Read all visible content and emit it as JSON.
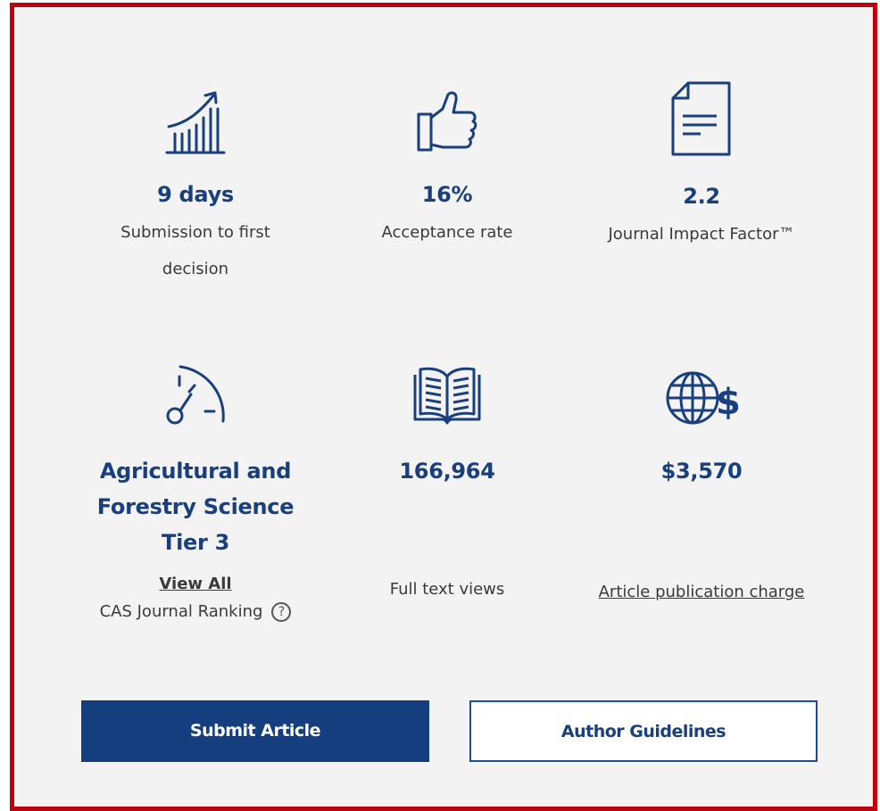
{
  "metrics": [
    {
      "icon": "growth-chart-icon",
      "value": "9 days",
      "label_line1": "Submission to first",
      "label_line2": "decision"
    },
    {
      "icon": "thumbs-up-icon",
      "value": "16%",
      "label": "Acceptance rate"
    },
    {
      "icon": "document-icon",
      "value": "2.2",
      "label": "Journal Impact Factor™"
    },
    {
      "icon": "speedometer-icon",
      "value_line1": "Agricultural and",
      "value_line2": "Forestry Science",
      "value_line3": "Tier 3",
      "link": "View All",
      "label": "CAS Journal Ranking",
      "help": "?"
    },
    {
      "icon": "open-book-icon",
      "value": "166,964",
      "label": "Full text views"
    },
    {
      "icon": "globe-dollar-icon",
      "value": "$3,570",
      "link": "Article publication charge"
    }
  ],
  "buttons": {
    "submit": "Submit Article",
    "guidelines": "Author Guidelines"
  },
  "colors": {
    "accent": "#153e7e",
    "frame": "#c0020f",
    "background": "#f3f3f3"
  }
}
